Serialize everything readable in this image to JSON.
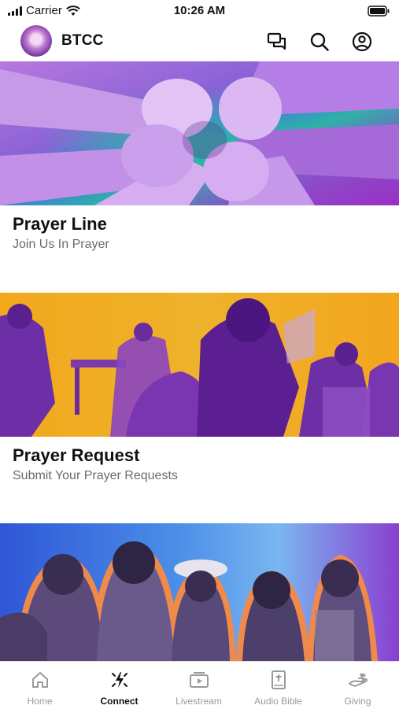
{
  "status_bar": {
    "carrier": "Carrier",
    "time": "10:26 AM"
  },
  "header": {
    "title": "BTCC",
    "logo_icon": "church-logo",
    "actions": [
      "messages-icon",
      "search-icon",
      "account-icon"
    ]
  },
  "cards": [
    {
      "title": "Prayer Line",
      "subtitle": "Join Us In Prayer",
      "image": "hands-joined-in-circle-photo"
    },
    {
      "title": "Prayer Request",
      "subtitle": "Submit Your Prayer Requests",
      "image": "worship-group-praying-photo"
    },
    {
      "title": "",
      "subtitle": "",
      "image": "women-group-photo"
    }
  ],
  "tabs": [
    {
      "label": "Home",
      "icon": "home-icon",
      "active": false
    },
    {
      "label": "Connect",
      "icon": "connect-icon",
      "active": true
    },
    {
      "label": "Livestream",
      "icon": "livestream-icon",
      "active": false
    },
    {
      "label": "Audio Bible",
      "icon": "bible-icon",
      "active": false
    },
    {
      "label": "Giving",
      "icon": "giving-icon",
      "active": false
    }
  ],
  "colors": {
    "accent_purple": "#9b4fd3",
    "accent_yellow": "#f2a81d",
    "accent_blue": "#3a6fe0",
    "accent_orange": "#f08a4b"
  }
}
